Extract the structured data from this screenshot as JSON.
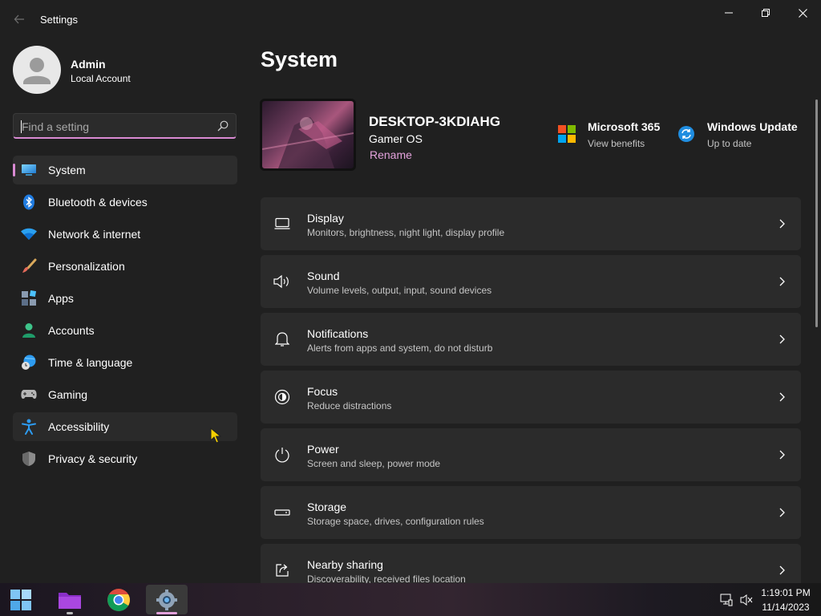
{
  "window": {
    "title": "Settings",
    "back_icon": "back-arrow-icon",
    "controls": [
      "minimize",
      "restore",
      "close"
    ]
  },
  "profile": {
    "name": "Admin",
    "account_type": "Local Account"
  },
  "search": {
    "placeholder": "Find a setting",
    "value": ""
  },
  "nav": {
    "items": [
      {
        "label": "System",
        "icon": "system-monitor-icon",
        "active": true
      },
      {
        "label": "Bluetooth & devices",
        "icon": "bluetooth-icon"
      },
      {
        "label": "Network & internet",
        "icon": "wifi-icon"
      },
      {
        "label": "Personalization",
        "icon": "brush-icon"
      },
      {
        "label": "Apps",
        "icon": "apps-icon"
      },
      {
        "label": "Accounts",
        "icon": "person-icon"
      },
      {
        "label": "Time & language",
        "icon": "globe-clock-icon"
      },
      {
        "label": "Gaming",
        "icon": "gamepad-icon"
      },
      {
        "label": "Accessibility",
        "icon": "accessibility-icon",
        "hover": true
      },
      {
        "label": "Privacy & security",
        "icon": "shield-icon"
      }
    ]
  },
  "page": {
    "title": "System"
  },
  "device": {
    "name": "DESKTOP-3KDIAHG",
    "os": "Gamer OS",
    "rename_label": "Rename"
  },
  "quick_links": {
    "microsoft365": {
      "title": "Microsoft 365",
      "subtitle": "View benefits",
      "icon": "microsoft-logo-icon"
    },
    "windows_update": {
      "title": "Windows Update",
      "subtitle": "Up to date",
      "icon": "update-sync-icon"
    }
  },
  "cards": [
    {
      "title": "Display",
      "subtitle": "Monitors, brightness, night light, display profile",
      "icon": "display-icon"
    },
    {
      "title": "Sound",
      "subtitle": "Volume levels, output, input, sound devices",
      "icon": "speaker-icon"
    },
    {
      "title": "Notifications",
      "subtitle": "Alerts from apps and system, do not disturb",
      "icon": "bell-icon"
    },
    {
      "title": "Focus",
      "subtitle": "Reduce distractions",
      "icon": "focus-icon"
    },
    {
      "title": "Power",
      "subtitle": "Screen and sleep, power mode",
      "icon": "power-icon"
    },
    {
      "title": "Storage",
      "subtitle": "Storage space, drives, configuration rules",
      "icon": "storage-drive-icon"
    },
    {
      "title": "Nearby sharing",
      "subtitle": "Discoverability, received files location",
      "icon": "share-icon"
    }
  ],
  "taskbar": {
    "apps": [
      "start-icon",
      "file-explorer-icon",
      "chrome-icon",
      "settings-gear-icon"
    ],
    "active_app": "settings-gear-icon",
    "time": "1:19:01 PM",
    "date": "11/14/2023"
  },
  "colors": {
    "background": "#202020",
    "card": "#2b2b2b",
    "accent": "#d98ad3",
    "accent_text": "#e3a2dc"
  }
}
